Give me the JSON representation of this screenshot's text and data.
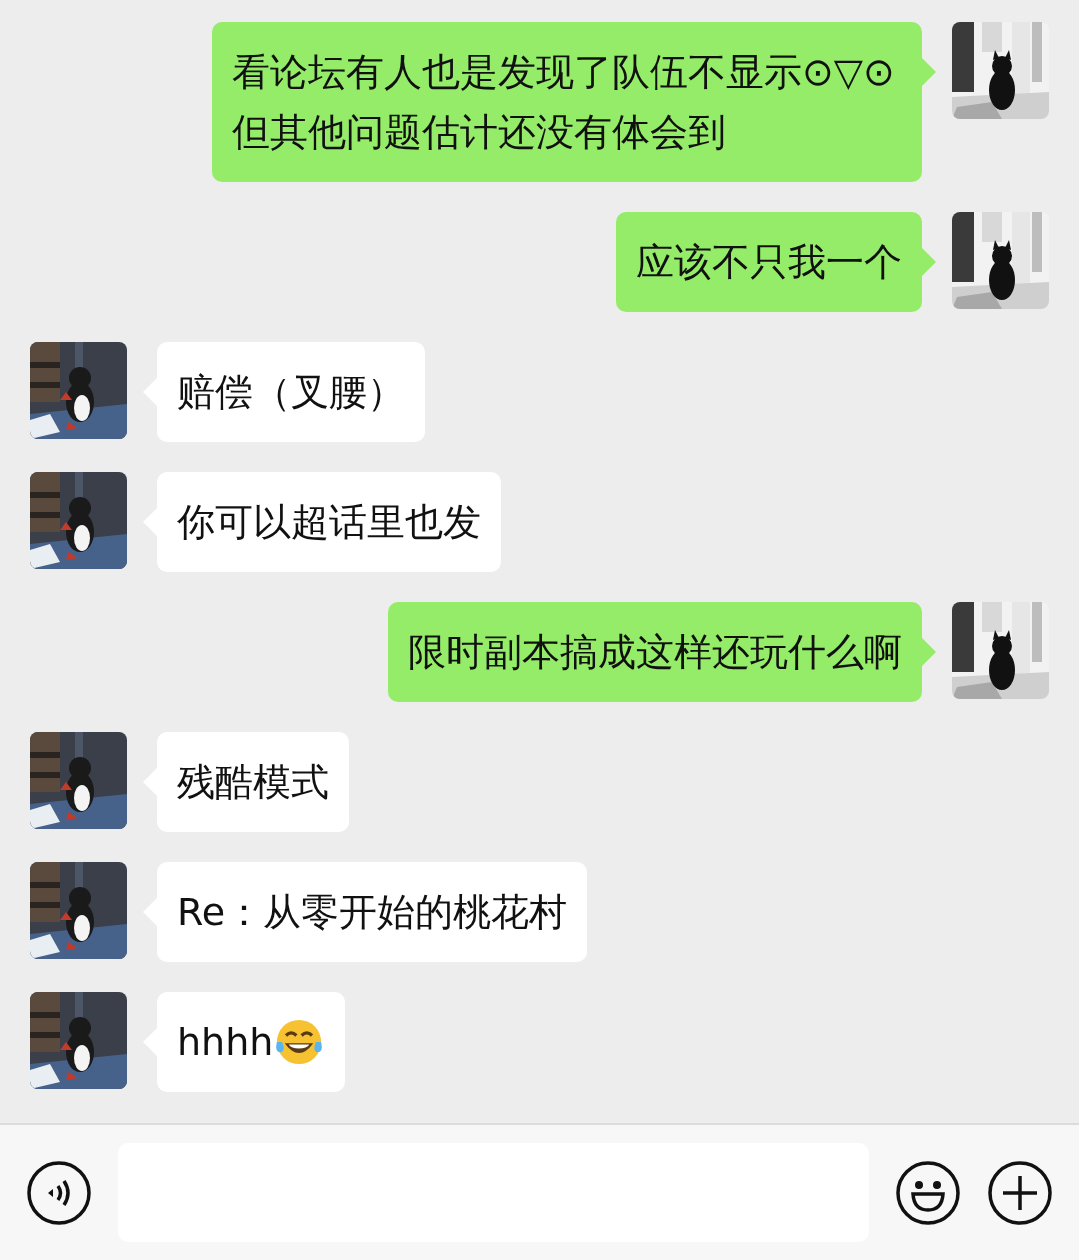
{
  "messages": [
    {
      "kind": "sent",
      "text": "看论坛有人也是发现了队伍不显示⊙▽⊙但其他问题估计还没有体会到"
    },
    {
      "kind": "sent",
      "text": "应该不只我一个"
    },
    {
      "kind": "received",
      "text": "赔偿（叉腰）"
    },
    {
      "kind": "received",
      "text": "你可以超话里也发"
    },
    {
      "kind": "sent",
      "text": "限时副本搞成这样还玩什么啊"
    },
    {
      "kind": "received",
      "text": "残酷模式"
    },
    {
      "kind": "received",
      "text": "Re：从零开始的桃花村"
    },
    {
      "kind": "received",
      "text": "hhhh",
      "emoji": true
    }
  ]
}
